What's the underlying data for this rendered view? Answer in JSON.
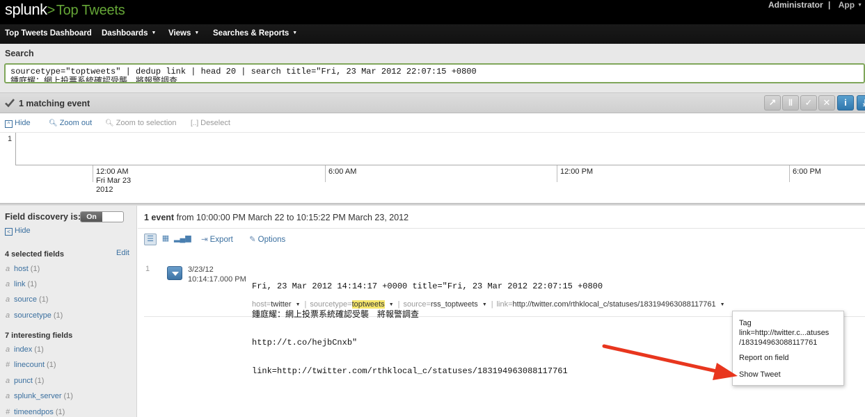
{
  "header": {
    "logo_text": "splunk",
    "logo_chevron": ">",
    "app_name": "Top Tweets",
    "user": "Administrator",
    "separator": "|",
    "app_menu": "App"
  },
  "nav": {
    "items": [
      {
        "label": "Top Tweets Dashboard",
        "dropdown": false
      },
      {
        "label": "Dashboards",
        "dropdown": true
      },
      {
        "label": "Views",
        "dropdown": true
      },
      {
        "label": "Searches & Reports",
        "dropdown": true
      }
    ]
  },
  "search": {
    "label": "Search",
    "query_line1": "sourcetype=\"toptweets\" | dedup link | head 20 | search title=\"Fri, 23 Mar 2012 22:07:15 +0800",
    "query_line2": "鍾庭耀：網上投票系統確認受襲　將報警調查"
  },
  "status": {
    "text": "1 matching event",
    "buttons": [
      "export-icon",
      "pause-icon",
      "finalize-icon",
      "cancel-icon",
      "info-icon",
      "jobs-icon"
    ]
  },
  "timeline": {
    "hide": "Hide",
    "zoom_out": "Zoom out",
    "zoom_to_selection": "Zoom to selection",
    "deselect": "Deselect",
    "y_count": "1",
    "labels": {
      "t1_time": "12:00 AM",
      "t1_day": "Fri Mar 23",
      "t1_year": "2012",
      "t2": "6:00 AM",
      "t3": "12:00 PM",
      "t4": "6:00 PM"
    }
  },
  "sidebar": {
    "field_discovery_label": "Field discovery is:",
    "toggle_state": "On",
    "hide": "Hide",
    "selected_title": "4 selected fields",
    "edit": "Edit",
    "selected": [
      {
        "type": "a",
        "name": "host",
        "count": "(1)"
      },
      {
        "type": "a",
        "name": "link",
        "count": "(1)"
      },
      {
        "type": "a",
        "name": "source",
        "count": "(1)"
      },
      {
        "type": "a",
        "name": "sourcetype",
        "count": "(1)"
      }
    ],
    "interesting_title": "7 interesting fields",
    "interesting": [
      {
        "type": "a",
        "name": "index",
        "count": "(1)"
      },
      {
        "type": "#",
        "name": "linecount",
        "count": "(1)"
      },
      {
        "type": "a",
        "name": "punct",
        "count": "(1)"
      },
      {
        "type": "a",
        "name": "splunk_server",
        "count": "(1)"
      },
      {
        "type": "#",
        "name": "timeendpos",
        "count": "(1)"
      }
    ]
  },
  "events": {
    "summary_count": "1 event",
    "summary_from": " from 10:00:00 PM March 22 to 10:15:22 PM March 23, 2012",
    "export": "Export",
    "options": "Options",
    "row": {
      "number": "1",
      "date": "3/23/12",
      "time": "10:14:17.000 PM",
      "raw_line1": "Fri, 23 Mar 2012 14:14:17 +0000 title=\"Fri, 23 Mar 2012 22:07:15 +0800",
      "raw_line2": "鍾庭耀：網上投票系統確認受襲　將報警調查",
      "raw_line3": "http://t.co/hejbCnxb\"",
      "raw_line4": "link=http://twitter.com/rthklocal_c/statuses/183194963088117761",
      "fields": [
        {
          "key": "host=",
          "value": "twitter",
          "highlight": false
        },
        {
          "key": "sourcetype=",
          "value": "toptweets",
          "highlight": true
        },
        {
          "key": "source=",
          "value": "rss_toptweets",
          "highlight": false
        },
        {
          "key": "link=",
          "value": "http://twitter.com/rthklocal_c/statuses/183194963088117761",
          "highlight": false
        }
      ]
    }
  },
  "context_menu": {
    "tag_label": "Tag",
    "tag_value_1": "link=http://twitter.c...atuses",
    "tag_value_2": "/183194963088117761",
    "report": "Report on field",
    "show_tweet": "Show Tweet"
  },
  "colors": {
    "accent_green": "#65a637",
    "link_blue": "#3a6f9f",
    "arrow_red": "#e8361e",
    "highlight_yellow": "#f5e66b"
  }
}
